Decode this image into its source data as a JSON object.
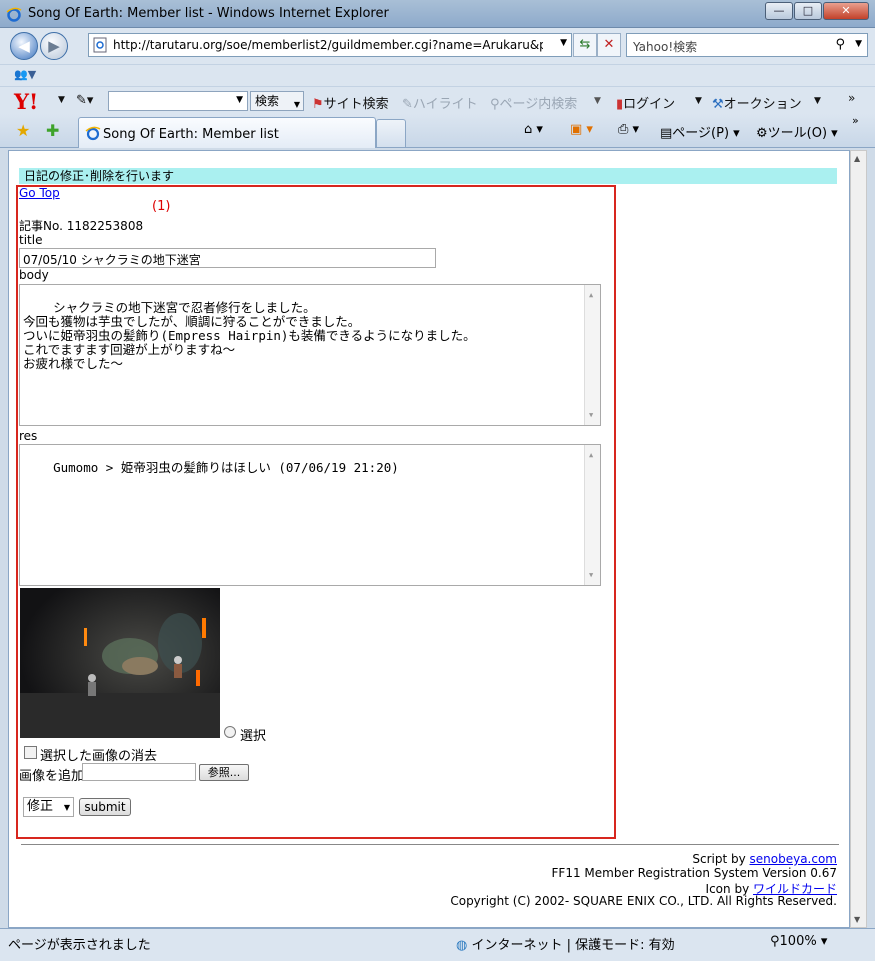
{
  "window": {
    "title": "Song Of Earth: Member list - Windows Internet Explorer",
    "minimize": "—",
    "maximize": "□",
    "close": "✕"
  },
  "address": {
    "url": "http://tarutaru.org/soe/memberlist2/guildmember.cgi?name=Arukaru&pas",
    "search_placeholder": "Yahoo!検索"
  },
  "yahoo_toolbar": {
    "logo": "Y!",
    "search_button": "検索",
    "site_search": "サイト検索",
    "highlight": "ハイライト",
    "page_search": "ページ内検索",
    "login": "ログイン",
    "auction": "オークション"
  },
  "tabs": [
    {
      "label": "Song Of Earth: Member list"
    }
  ],
  "commands": {
    "page": "ページ(P)",
    "tools": "ツール(O)"
  },
  "page": {
    "banner": "日記の修正･削除を行います",
    "go_top": "Go Top",
    "marker": "(1)",
    "article_no_label": "記事No. 1182253808",
    "title_label": "title",
    "title_value": "07/05/10 シャクラミの地下迷宮",
    "body_label": "body",
    "body_value": "シャクラミの地下迷宮で忍者修行をしました。\n今回も獲物は芋虫でしたが、順調に狩ることができました。\nついに姫帝羽虫の髪飾り(Empress Hairpin)も装備できるようになりました。\nこれでますます回避が上がりますね～\nお疲れ様でした～",
    "res_label": "res",
    "res_value": "Gumomo > 姫帝羽虫の髪飾りはほしい (07/06/19 21:20)",
    "radio_label": "選択",
    "delete_checkbox_label": "選択した画像の消去",
    "add_image_label": "画像を追加",
    "browse_button": "参照...",
    "mode_select": "修正",
    "submit_button": "submit"
  },
  "footer": {
    "script_by": "Script by ",
    "script_link": "senobeya.com",
    "system": "FF11 Member Registration System Version 0.67",
    "icon_by": "Icon by ",
    "icon_link": "ワイルドカード",
    "copyright": "Copyright (C) 2002- SQUARE ENIX CO., LTD. All Rights Reserved."
  },
  "statusbar": {
    "text": "ページが表示されました",
    "zone": "インターネット | 保護モード: 有効",
    "zoom": "100%"
  },
  "colors": {
    "banner_bg": "#aaf0f0",
    "highlight_border": "#d7261e",
    "link": "#0000ee"
  }
}
